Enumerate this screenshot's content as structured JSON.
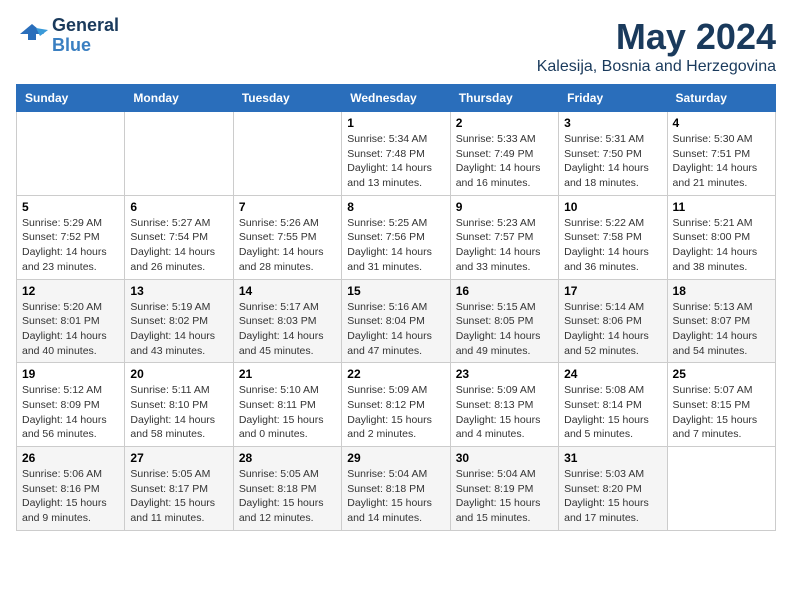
{
  "header": {
    "logo_line1": "General",
    "logo_line2": "Blue",
    "month": "May 2024",
    "location": "Kalesija, Bosnia and Herzegovina"
  },
  "weekdays": [
    "Sunday",
    "Monday",
    "Tuesday",
    "Wednesday",
    "Thursday",
    "Friday",
    "Saturday"
  ],
  "weeks": [
    [
      {
        "day": "",
        "info": ""
      },
      {
        "day": "",
        "info": ""
      },
      {
        "day": "",
        "info": ""
      },
      {
        "day": "1",
        "info": "Sunrise: 5:34 AM\nSunset: 7:48 PM\nDaylight: 14 hours\nand 13 minutes."
      },
      {
        "day": "2",
        "info": "Sunrise: 5:33 AM\nSunset: 7:49 PM\nDaylight: 14 hours\nand 16 minutes."
      },
      {
        "day": "3",
        "info": "Sunrise: 5:31 AM\nSunset: 7:50 PM\nDaylight: 14 hours\nand 18 minutes."
      },
      {
        "day": "4",
        "info": "Sunrise: 5:30 AM\nSunset: 7:51 PM\nDaylight: 14 hours\nand 21 minutes."
      }
    ],
    [
      {
        "day": "5",
        "info": "Sunrise: 5:29 AM\nSunset: 7:52 PM\nDaylight: 14 hours\nand 23 minutes."
      },
      {
        "day": "6",
        "info": "Sunrise: 5:27 AM\nSunset: 7:54 PM\nDaylight: 14 hours\nand 26 minutes."
      },
      {
        "day": "7",
        "info": "Sunrise: 5:26 AM\nSunset: 7:55 PM\nDaylight: 14 hours\nand 28 minutes."
      },
      {
        "day": "8",
        "info": "Sunrise: 5:25 AM\nSunset: 7:56 PM\nDaylight: 14 hours\nand 31 minutes."
      },
      {
        "day": "9",
        "info": "Sunrise: 5:23 AM\nSunset: 7:57 PM\nDaylight: 14 hours\nand 33 minutes."
      },
      {
        "day": "10",
        "info": "Sunrise: 5:22 AM\nSunset: 7:58 PM\nDaylight: 14 hours\nand 36 minutes."
      },
      {
        "day": "11",
        "info": "Sunrise: 5:21 AM\nSunset: 8:00 PM\nDaylight: 14 hours\nand 38 minutes."
      }
    ],
    [
      {
        "day": "12",
        "info": "Sunrise: 5:20 AM\nSunset: 8:01 PM\nDaylight: 14 hours\nand 40 minutes."
      },
      {
        "day": "13",
        "info": "Sunrise: 5:19 AM\nSunset: 8:02 PM\nDaylight: 14 hours\nand 43 minutes."
      },
      {
        "day": "14",
        "info": "Sunrise: 5:17 AM\nSunset: 8:03 PM\nDaylight: 14 hours\nand 45 minutes."
      },
      {
        "day": "15",
        "info": "Sunrise: 5:16 AM\nSunset: 8:04 PM\nDaylight: 14 hours\nand 47 minutes."
      },
      {
        "day": "16",
        "info": "Sunrise: 5:15 AM\nSunset: 8:05 PM\nDaylight: 14 hours\nand 49 minutes."
      },
      {
        "day": "17",
        "info": "Sunrise: 5:14 AM\nSunset: 8:06 PM\nDaylight: 14 hours\nand 52 minutes."
      },
      {
        "day": "18",
        "info": "Sunrise: 5:13 AM\nSunset: 8:07 PM\nDaylight: 14 hours\nand 54 minutes."
      }
    ],
    [
      {
        "day": "19",
        "info": "Sunrise: 5:12 AM\nSunset: 8:09 PM\nDaylight: 14 hours\nand 56 minutes."
      },
      {
        "day": "20",
        "info": "Sunrise: 5:11 AM\nSunset: 8:10 PM\nDaylight: 14 hours\nand 58 minutes."
      },
      {
        "day": "21",
        "info": "Sunrise: 5:10 AM\nSunset: 8:11 PM\nDaylight: 15 hours\nand 0 minutes."
      },
      {
        "day": "22",
        "info": "Sunrise: 5:09 AM\nSunset: 8:12 PM\nDaylight: 15 hours\nand 2 minutes."
      },
      {
        "day": "23",
        "info": "Sunrise: 5:09 AM\nSunset: 8:13 PM\nDaylight: 15 hours\nand 4 minutes."
      },
      {
        "day": "24",
        "info": "Sunrise: 5:08 AM\nSunset: 8:14 PM\nDaylight: 15 hours\nand 5 minutes."
      },
      {
        "day": "25",
        "info": "Sunrise: 5:07 AM\nSunset: 8:15 PM\nDaylight: 15 hours\nand 7 minutes."
      }
    ],
    [
      {
        "day": "26",
        "info": "Sunrise: 5:06 AM\nSunset: 8:16 PM\nDaylight: 15 hours\nand 9 minutes."
      },
      {
        "day": "27",
        "info": "Sunrise: 5:05 AM\nSunset: 8:17 PM\nDaylight: 15 hours\nand 11 minutes."
      },
      {
        "day": "28",
        "info": "Sunrise: 5:05 AM\nSunset: 8:18 PM\nDaylight: 15 hours\nand 12 minutes."
      },
      {
        "day": "29",
        "info": "Sunrise: 5:04 AM\nSunset: 8:18 PM\nDaylight: 15 hours\nand 14 minutes."
      },
      {
        "day": "30",
        "info": "Sunrise: 5:04 AM\nSunset: 8:19 PM\nDaylight: 15 hours\nand 15 minutes."
      },
      {
        "day": "31",
        "info": "Sunrise: 5:03 AM\nSunset: 8:20 PM\nDaylight: 15 hours\nand 17 minutes."
      },
      {
        "day": "",
        "info": ""
      }
    ]
  ]
}
